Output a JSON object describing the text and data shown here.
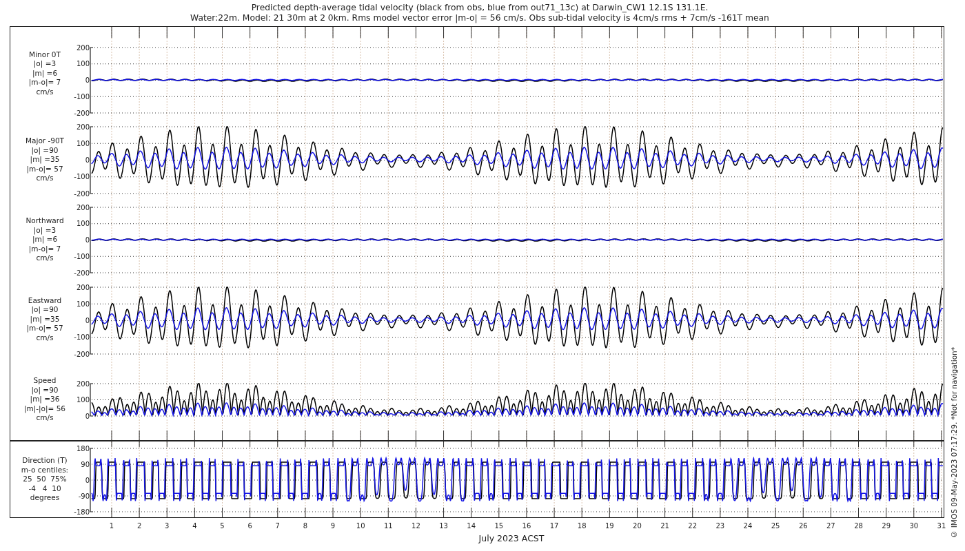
{
  "title_lines": [
    "Predicted depth-average tidal velocity (black from obs, blue from out71_13c) at Darwin_CW1 12.1S 131.1E.",
    "Water:22m. Model: 21 30m at 2 0km. Rms model vector error |m-o| = 56 cm/s. Obs sub-tidal velocity is 4cm/s rms + 7cm/s -161T mean"
  ],
  "panels": [
    {
      "kind": "weak",
      "label_lines": [
        "Minor 0T",
        "|o| =3",
        "|m| =6",
        "|m-o|= 7",
        "cm/s"
      ],
      "yticks": [
        "200",
        "100",
        "0",
        "-100",
        "-200"
      ]
    },
    {
      "kind": "strong",
      "label_lines": [
        "Major -90T",
        "|o| =90",
        "|m| =35",
        "|m-o|= 57",
        "cm/s"
      ],
      "yticks": [
        "200",
        "100",
        "0",
        "-100",
        "-200"
      ]
    },
    {
      "kind": "weak",
      "label_lines": [
        "Northward",
        "|o| =3",
        "|m| =6",
        "|m-o|= 7",
        "cm/s"
      ],
      "yticks": [
        "200",
        "100",
        "0",
        "-100",
        "-200"
      ]
    },
    {
      "kind": "strong",
      "label_lines": [
        "Eastward",
        "|o| =90",
        "|m| =35",
        "|m-o|= 57",
        "cm/s"
      ],
      "yticks": [
        "200",
        "100",
        "0",
        "-100",
        "-200"
      ]
    },
    {
      "kind": "speed",
      "label_lines": [
        "Speed",
        "|o| =90",
        "|m| =36",
        "|m|-|o|= 56",
        "cm/s"
      ],
      "yticks": [
        "200",
        "100",
        "0"
      ]
    },
    {
      "kind": "direction",
      "label_lines": [
        "Direction (T)",
        "m-o centiles:",
        "25  50  75%",
        "-4   4  10",
        "degrees"
      ],
      "yticks": [
        "180",
        "90",
        "0",
        "-90",
        "-180"
      ]
    }
  ],
  "x_axis": {
    "ticks": [
      "1",
      "2",
      "3",
      "4",
      "5",
      "6",
      "7",
      "8",
      "9",
      "10",
      "11",
      "12",
      "13",
      "14",
      "15",
      "16",
      "17",
      "18",
      "19",
      "20",
      "21",
      "22",
      "23",
      "24",
      "25",
      "26",
      "27",
      "28",
      "29",
      "30",
      "31"
    ],
    "label": "July 2023 ACST"
  },
  "side_note": "© IMOS 09-May-2023 07:17:29. *Not for navigation*"
}
